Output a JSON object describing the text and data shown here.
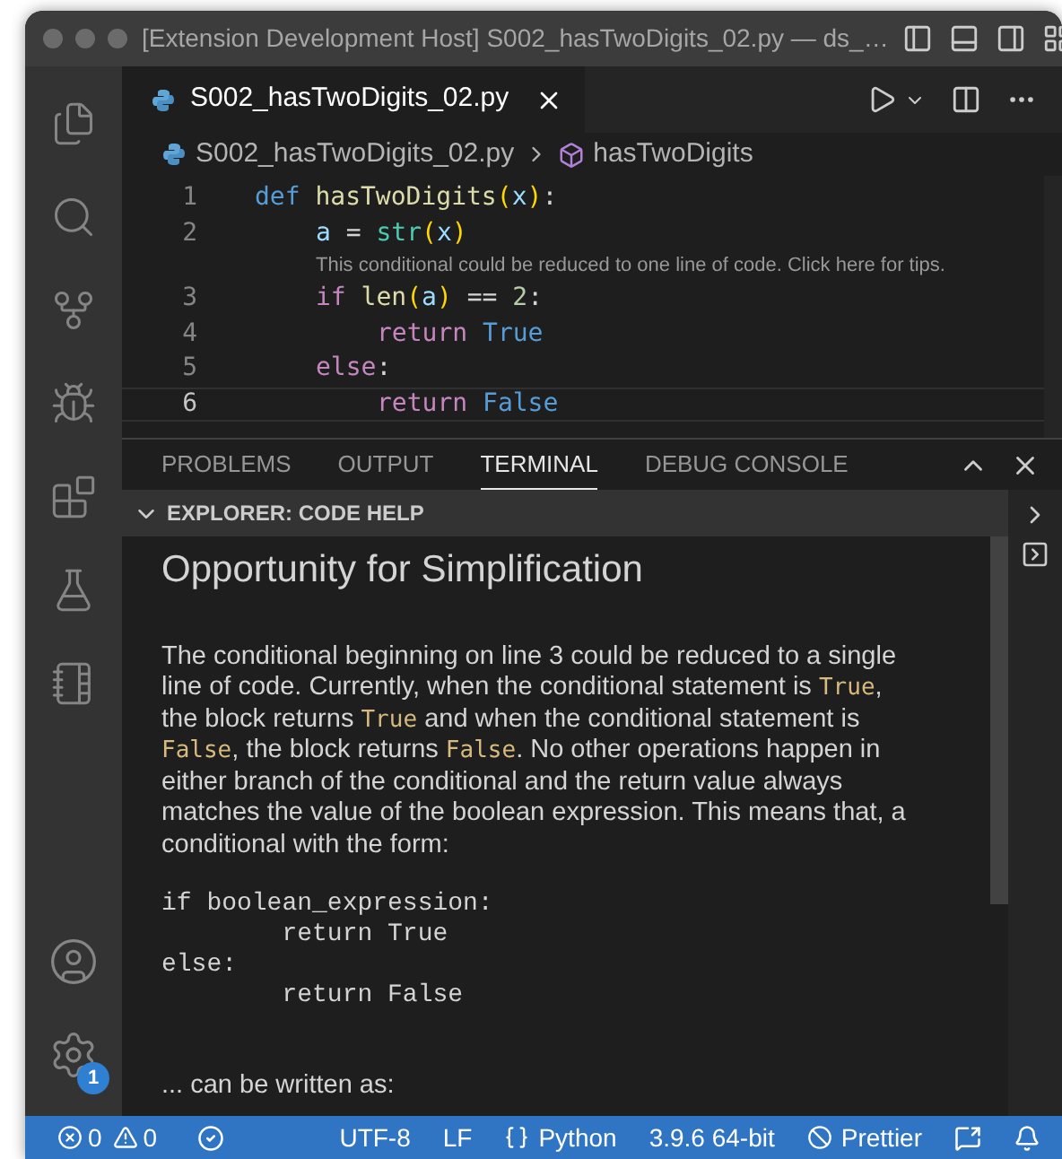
{
  "window": {
    "title": "[Extension Development Host] S002_hasTwoDigits_02.py — ds_…"
  },
  "activity_bar": {
    "settings_badge": "1"
  },
  "editor": {
    "tab": {
      "label": "S002_hasTwoDigits_02.py",
      "selected": true
    },
    "breadcrumb": [
      "S002_hasTwoDigits_02.py",
      "hasTwoDigits"
    ],
    "lines": [
      {
        "number": "1",
        "current": false,
        "tokens": [
          {
            "text": "def ",
            "kind": "storage"
          },
          {
            "text": "hasTwoDigits",
            "kind": "function"
          },
          {
            "text": "(",
            "kind": "paren"
          },
          {
            "text": "x",
            "kind": "variable"
          },
          {
            "text": ")",
            "kind": "paren"
          },
          {
            "text": ":",
            "kind": "plain"
          }
        ],
        "children": [
          {
            "number": "2",
            "current": false,
            "tokens": [
              {
                "text": "a",
                "kind": "variable"
              },
              {
                "text": " = ",
                "kind": "plain"
              },
              {
                "text": "str",
                "kind": "type"
              },
              {
                "text": "(",
                "kind": "paren"
              },
              {
                "text": "x",
                "kind": "variable"
              },
              {
                "text": ")",
                "kind": "paren"
              }
            ],
            "hint": "This conditional could be reduced to one line of code. Click here for tips."
          },
          {
            "number": "3",
            "current": false,
            "tokens": [
              {
                "text": "if ",
                "kind": "keyword"
              },
              {
                "text": "len",
                "kind": "function"
              },
              {
                "text": "(",
                "kind": "paren"
              },
              {
                "text": "a",
                "kind": "variable"
              },
              {
                "text": ")",
                "kind": "paren"
              },
              {
                "text": " == ",
                "kind": "plain"
              },
              {
                "text": "2",
                "kind": "number"
              },
              {
                "text": ":",
                "kind": "plain"
              }
            ],
            "children": [
              {
                "number": "4",
                "current": false,
                "tokens": [
                  {
                    "text": "return ",
                    "kind": "keyword"
                  },
                  {
                    "text": "True",
                    "kind": "storage"
                  }
                ]
              }
            ]
          },
          {
            "number": "5",
            "current": false,
            "tokens": [
              {
                "text": "else",
                "kind": "keyword"
              },
              {
                "text": ":",
                "kind": "plain"
              }
            ],
            "children": [
              {
                "number": "6",
                "current": true,
                "tokens": [
                  {
                    "text": "return ",
                    "kind": "keyword"
                  },
                  {
                    "text": "False",
                    "kind": "storage"
                  }
                ]
              }
            ]
          }
        ]
      }
    ]
  },
  "panel": {
    "tabs": [
      {
        "label": "PROBLEMS",
        "selected": false
      },
      {
        "label": "OUTPUT",
        "selected": false
      },
      {
        "label": "TERMINAL",
        "selected": true
      },
      {
        "label": "DEBUG CONSOLE",
        "selected": false
      }
    ],
    "section": {
      "title": "EXPLORER: CODE HELP",
      "expanded": true
    },
    "heading": "Opportunity for Simplification",
    "paragraph": [
      {
        "text": "The conditional beginning on line 3 could be reduced to a single line of code. Currently, when the conditional statement is ",
        "kind": "text"
      },
      {
        "text": "True",
        "kind": "code"
      },
      {
        "text": ", the block returns ",
        "kind": "text"
      },
      {
        "text": "True",
        "kind": "code"
      },
      {
        "text": " and when the conditional statement is ",
        "kind": "text"
      },
      {
        "text": "False",
        "kind": "code"
      },
      {
        "text": ", the block returns ",
        "kind": "text"
      },
      {
        "text": "False",
        "kind": "code"
      },
      {
        "text": ". No other operations happen in either branch of the conditional and the return value always matches the value of the boolean expression. This means that, a conditional with the form:",
        "kind": "text"
      }
    ],
    "code_block": [
      "if boolean_expression:",
      "        return True",
      "else:",
      "        return False"
    ],
    "footer": "... can be written as:"
  },
  "status_bar": {
    "errors": "0",
    "warnings": "0",
    "items": [
      {
        "text": "UTF-8",
        "kind": "text"
      },
      {
        "text": "LF",
        "kind": "text"
      },
      {
        "text": "Python",
        "kind": "language"
      },
      {
        "text": "3.9.6 64-bit",
        "kind": "text"
      },
      {
        "text": "Prettier",
        "kind": "formatter"
      }
    ]
  }
}
